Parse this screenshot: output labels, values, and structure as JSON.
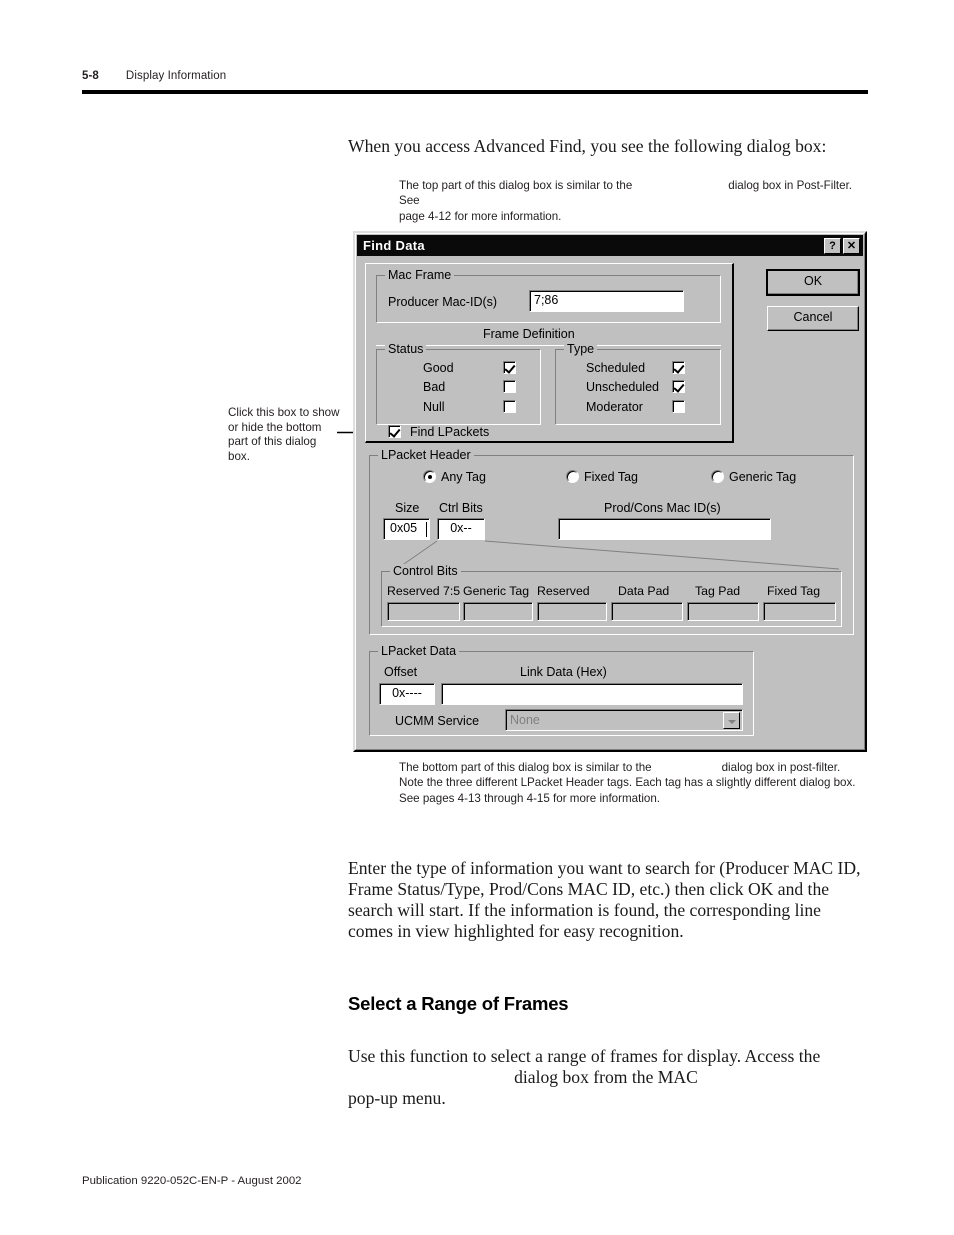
{
  "header": {
    "folio": "5-8",
    "chapter_title": "Display Information"
  },
  "intro_paragraph": "When you access Advanced Find, you see the following dialog box:",
  "caption_top": {
    "line1_before_gap": "The top part of this dialog box is similar to the",
    "line1_after_gap": "dialog box in Post-Filter. See",
    "line2": "page 4-12 for more information."
  },
  "callout": {
    "text": "Click this box to show or hide the bottom part of this dialog box."
  },
  "dialog": {
    "title": "Find Data",
    "titlebar_buttons": {
      "help": "?",
      "close": "✕"
    },
    "buttons": {
      "ok": "OK",
      "cancel": "Cancel"
    },
    "mac_frame": {
      "group_label": "Mac Frame",
      "producer_label": "Producer Mac-ID(s)",
      "producer_value": "7;86"
    },
    "frame_definition_label": "Frame Definition",
    "status": {
      "group_label": "Status",
      "items": [
        {
          "label": "Good",
          "checked": true
        },
        {
          "label": "Bad",
          "checked": false
        },
        {
          "label": "Null",
          "checked": false
        }
      ]
    },
    "type": {
      "group_label": "Type",
      "items": [
        {
          "label": "Scheduled",
          "checked": true
        },
        {
          "label": "Unscheduled",
          "checked": true
        },
        {
          "label": "Moderator",
          "checked": false
        }
      ]
    },
    "find_lpackets": {
      "label": "Find LPackets",
      "checked": true
    },
    "lpacket_header": {
      "group_label": "LPacket Header",
      "radios": [
        {
          "label": "Any Tag",
          "selected": true
        },
        {
          "label": "Fixed Tag",
          "selected": false
        },
        {
          "label": "Generic Tag",
          "selected": false
        }
      ],
      "size_label": "Size",
      "size_value": "0x05",
      "ctrl_bits_label": "Ctrl Bits",
      "ctrl_bits_value": "0x--",
      "prodcons_label": "Prod/Cons Mac ID(s)",
      "prodcons_value": ""
    },
    "control_bits": {
      "group_label": "Control Bits",
      "columns": [
        {
          "header": "Reserved 7:5",
          "value": ""
        },
        {
          "header": "Generic Tag",
          "value": ""
        },
        {
          "header": "Reserved",
          "value": ""
        },
        {
          "header": "Data Pad",
          "value": ""
        },
        {
          "header": "Tag Pad",
          "value": ""
        },
        {
          "header": "Fixed Tag",
          "value": ""
        }
      ]
    },
    "lpacket_data": {
      "group_label": "LPacket Data",
      "offset_label": "Offset",
      "offset_value": "0x----",
      "link_data_label": "Link Data (Hex)",
      "link_data_value": "",
      "ucmm_label": "UCMM Service",
      "ucmm_value": "None"
    }
  },
  "caption_bottom": {
    "line1_before_gap": "The bottom part of this dialog box is similar to the",
    "line1_after_gap": "dialog box in post-filter.",
    "line2": "Note the three different LPacket Header tags. Each tag has a slightly different dialog box.",
    "line3": "See pages 4-13 through 4-15 for more information."
  },
  "body_paragraph_2": "Enter the type of information you want to search for (Producer MAC ID, Frame Status/Type, Prod/Cons MAC ID, etc.) then click OK and the search will start. If the information is found, the corresponding line comes in view highlighted for easy recognition.",
  "section_heading": "Select a Range of Frames",
  "body_paragraph_3": {
    "line1": "Use this function to select a range of frames for display. Access the",
    "line2": "dialog box from the MAC",
    "line3": "pop-up menu."
  },
  "footer": "Publication 9220-052C-EN-P - August 2002"
}
